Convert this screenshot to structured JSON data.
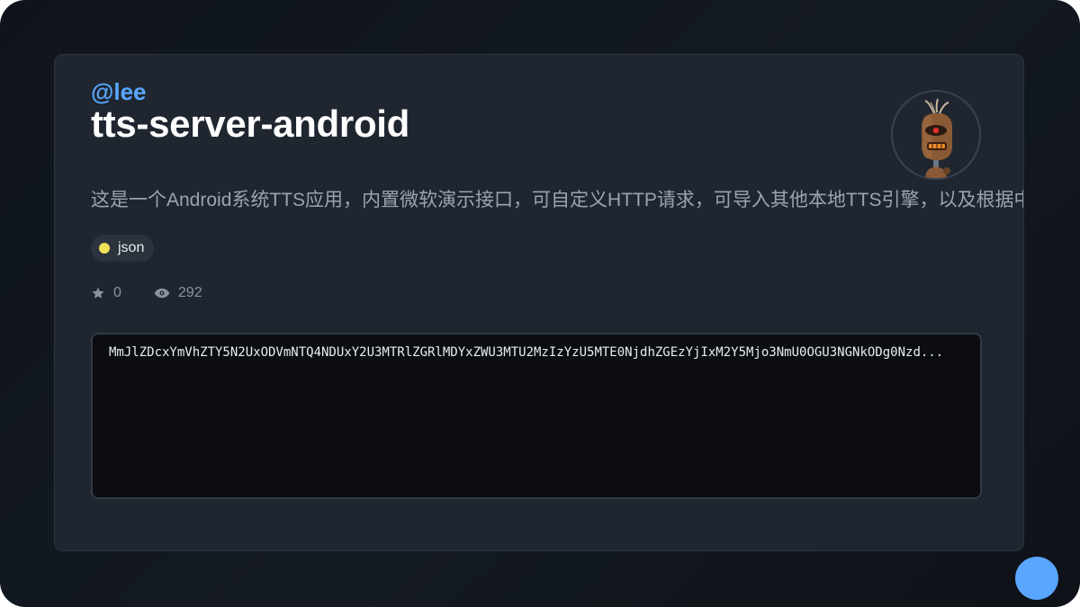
{
  "repo": {
    "owner": "@lee",
    "name": "tts-server-android",
    "description": "这是一个Android系统TTS应用，内置微软演示接口，可自定义HTTP请求，可导入其他本地TTS引擎，以及根据中文双引号的简单旁白/对话识别朗读，还有自动重试，备用配置，文本替换等更多功能。",
    "language": {
      "label": "json",
      "color": "#f1e05a"
    },
    "stars": "0",
    "views": "292"
  },
  "code_preview": {
    "text": "MmJlZDcxYmVhZTY5N2UxODVmNTQ4NDUxY2U3MTRlZGRlMDYxZWU3MTU2MzIzYzU5MTE0NjdhZGEzYjIxM2Y5Mjo3NmU0OGU3NGNkODg0Nzd..."
  },
  "icons": {
    "star": "star-icon",
    "views": "eye-icon",
    "avatar": "robot-avatar"
  },
  "colors": {
    "accent": "#58a6ff",
    "language_dot": "#f1e05a",
    "card_background": "#1f2630"
  }
}
